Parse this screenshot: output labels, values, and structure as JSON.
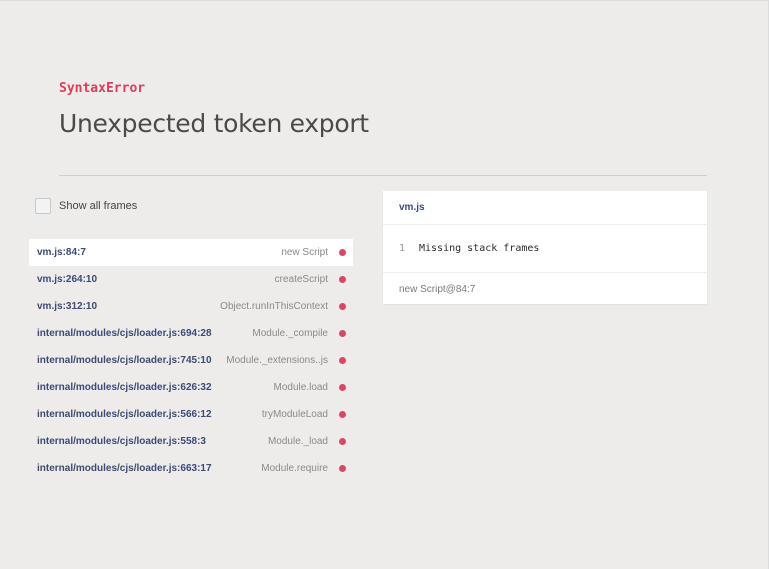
{
  "error": {
    "name": "SyntaxError",
    "message": "Unexpected token export"
  },
  "toggle": {
    "label": "Show all frames",
    "checked": false
  },
  "frames": [
    {
      "file": "vm.js:84:7",
      "method": "new Script",
      "active": true
    },
    {
      "file": "vm.js:264:10",
      "method": "createScript",
      "active": false
    },
    {
      "file": "vm.js:312:10",
      "method": "Object.runInThisContext",
      "active": false
    },
    {
      "file": "internal/modules/cjs/loader.js:694:28",
      "method": "Module._compile",
      "active": false
    },
    {
      "file": "internal/modules/cjs/loader.js:745:10",
      "method": "Module._extensions..js",
      "active": false
    },
    {
      "file": "internal/modules/cjs/loader.js:626:32",
      "method": "Module.load",
      "active": false
    },
    {
      "file": "internal/modules/cjs/loader.js:566:12",
      "method": "tryModuleLoad",
      "active": false
    },
    {
      "file": "internal/modules/cjs/loader.js:558:3",
      "method": "Module._load",
      "active": false
    },
    {
      "file": "internal/modules/cjs/loader.js:663:17",
      "method": "Module.require",
      "active": false
    }
  ],
  "code_panel": {
    "filename": "vm.js",
    "line_number": "1",
    "line_code": "Missing stack frames",
    "footer": "new Script@84:7"
  },
  "colors": {
    "background": "#edecea",
    "accent_red": "#d63f5a",
    "file_link": "#3c4a75",
    "frame_dot": "#d64a60"
  }
}
